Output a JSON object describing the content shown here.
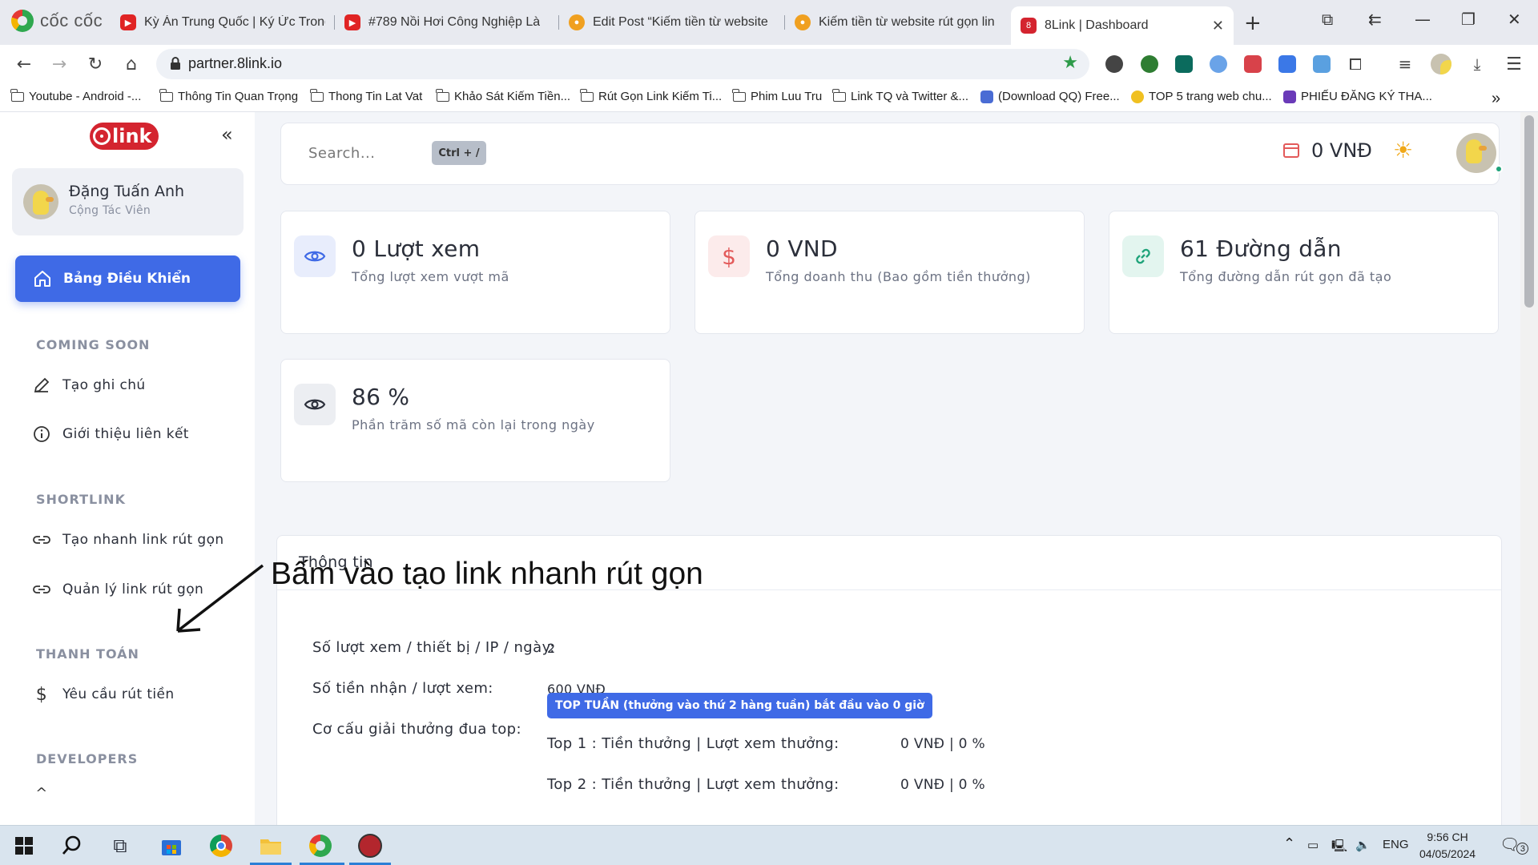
{
  "browser": {
    "brand": "cốc cốc",
    "tabs": [
      {
        "title": "Kỳ Án Trung Quốc | Ký Ức Trong"
      },
      {
        "title": "#789 Nồi Hơi Công Nghiệp Là"
      },
      {
        "title": "Edit Post “Kiếm tiền từ website"
      },
      {
        "title": "Kiếm tiền từ website rút gọn lin"
      },
      {
        "title": "8Link | Dashboard"
      }
    ],
    "url": "partner.8link.io",
    "bookmarks": [
      "Youtube - Android -...",
      "Thông Tin Quan Trọng",
      "Thong Tin Lat Vat",
      "Khảo Sát Kiếm Tiền...",
      "Rút Gọn Link Kiếm Ti...",
      "Phim Luu Tru",
      "Link TQ và Twitter &...",
      "(Download QQ) Free...",
      "TOP 5 trang web chu...",
      "PHIẾU ĐĂNG KÝ THA..."
    ]
  },
  "sidebar": {
    "logo_text": "link",
    "user": {
      "name": "Đặng Tuấn Anh",
      "role": "Cộng Tác Viên"
    },
    "active_item": "Bảng Điều Khiển",
    "sections": [
      {
        "title": "COMING SOON",
        "items": [
          "Tạo ghi chú",
          "Giới thiệu liên kết"
        ]
      },
      {
        "title": "SHORTLINK",
        "items": [
          "Tạo nhanh link rút gọn",
          "Quản lý link rút gọn"
        ]
      },
      {
        "title": "THANH TOÁN",
        "items": [
          "Yêu cầu rút tiền"
        ]
      },
      {
        "title": "DEVELOPERS",
        "items": []
      }
    ]
  },
  "topbar": {
    "search_placeholder": "Search...",
    "shortcut": "Ctrl + /",
    "balance": "0 VNĐ"
  },
  "stats": [
    {
      "value": "0 Lượt xem",
      "label": "Tổng lượt xem vượt mã",
      "icon": "eye-icon",
      "color": "#3f6ae6"
    },
    {
      "value": "0 VND",
      "label": "Tổng doanh thu (Bao gồm tiền thưởng)",
      "icon": "dollar-icon",
      "color": "#e35a5a"
    },
    {
      "value": "61 Đường dẫn",
      "label": "Tổng đường dẫn rút gọn đã tạo",
      "icon": "link-icon",
      "color": "#1fa37a"
    },
    {
      "value": "86 %",
      "label": "Phần trăm số mã còn lại trong ngày",
      "icon": "eye-icon",
      "color": "#2b2f3a"
    }
  ],
  "annotation": "Bấm vào tạo link nhanh rút gọn",
  "info": {
    "title": "Thông tin",
    "rows": [
      {
        "label": "Số lượt xem / thiết bị / IP / ngày:",
        "value": "2"
      },
      {
        "label": "Số tiền nhận / lượt xem:",
        "value": "600 VNĐ"
      },
      {
        "label": "Cơ cấu giải thưởng đua top:",
        "value": ""
      }
    ],
    "badge": "TOP TUẦN (thưởng vào thứ 2 hàng tuần) bắt đầu vào 0 giờ",
    "top_rows": [
      {
        "label": "Top 1 : Tiền thưởng | Lượt xem thưởng:",
        "value": "0 VNĐ | 0 %"
      },
      {
        "label": "Top 2 : Tiền thưởng | Lượt xem thưởng:",
        "value": "0 VNĐ | 0 %"
      }
    ]
  },
  "taskbar": {
    "lang": "ENG",
    "time": "9:56 CH",
    "date": "04/05/2024",
    "notifications": "3"
  },
  "colors": {
    "accent": "#3f6ae6",
    "brand_red": "#d4242f",
    "success": "#1fa37a",
    "danger": "#e35a5a"
  }
}
